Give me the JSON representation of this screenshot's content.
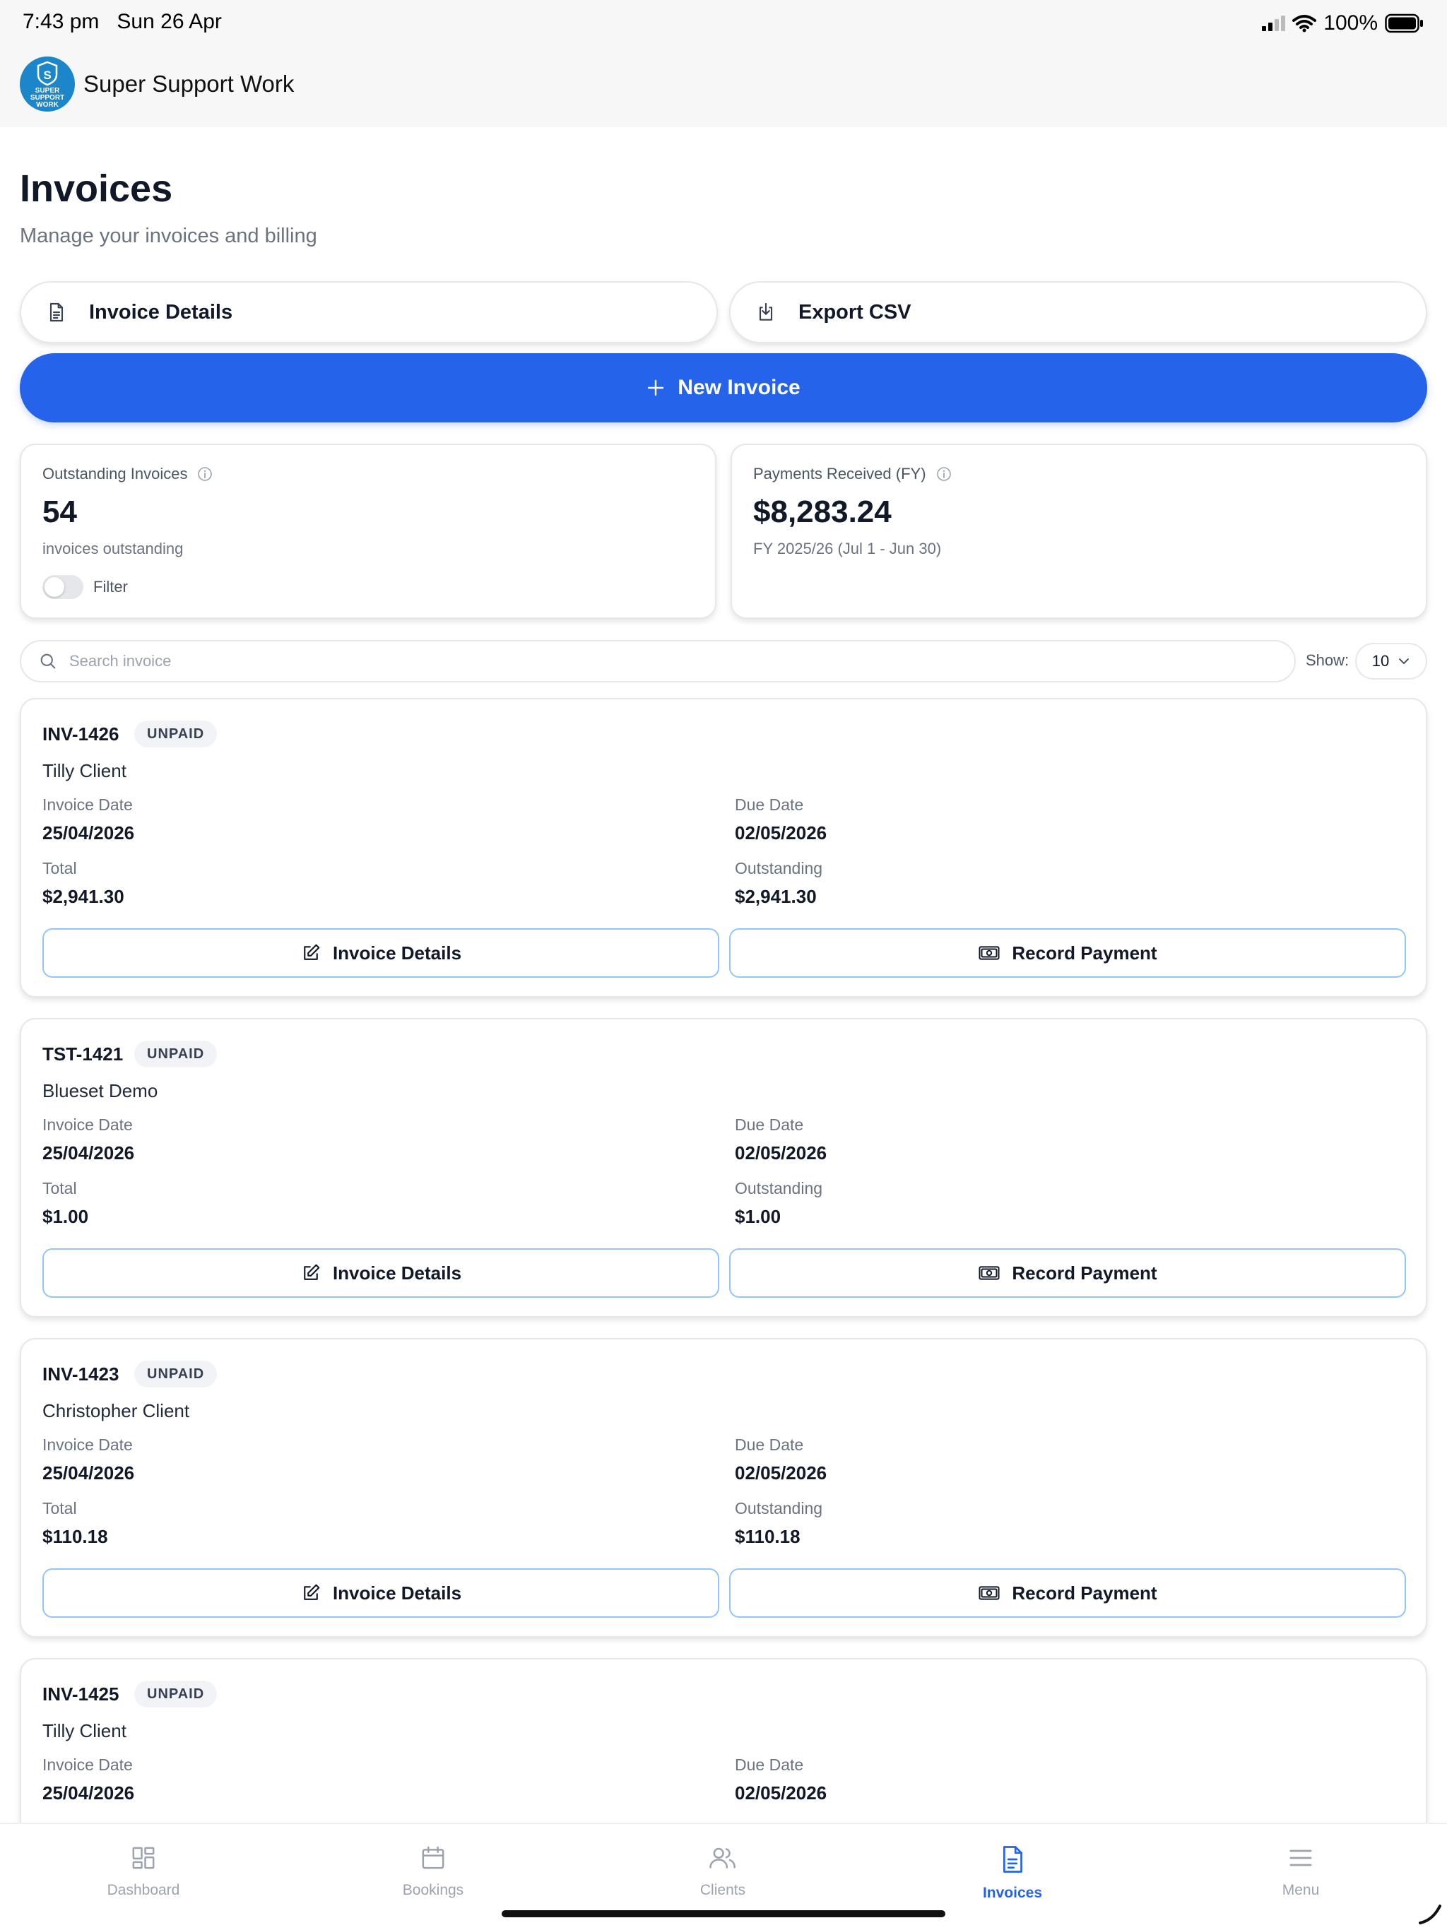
{
  "status_bar": {
    "time": "7:43 pm",
    "date": "Sun 26 Apr",
    "battery": "100%"
  },
  "header": {
    "app_title": "Super Support Work",
    "logo_text": "SUPER SUPPORT WORK",
    "logo_icon": "shield-s-icon"
  },
  "page": {
    "title": "Invoices",
    "subtitle": "Manage your invoices and billing"
  },
  "actions": {
    "invoice_details": "Invoice Details",
    "export_csv": "Export CSV",
    "new_invoice": "New Invoice"
  },
  "stats": {
    "outstanding": {
      "label": "Outstanding Invoices",
      "value": "54",
      "sub": "invoices outstanding",
      "filter_label": "Filter",
      "filter_on": false
    },
    "payments": {
      "label": "Payments Received (FY)",
      "value": "$8,283.24",
      "sub": "FY 2025/26 (Jul 1 - Jun 30)"
    }
  },
  "search": {
    "placeholder": "Search invoice",
    "show_label": "Show:",
    "show_value": "10"
  },
  "labels": {
    "invoice_date": "Invoice Date",
    "due_date": "Due Date",
    "total": "Total",
    "outstanding": "Outstanding",
    "invoice_details_btn": "Invoice Details",
    "record_payment_btn": "Record Payment"
  },
  "invoices": [
    {
      "number": "INV-1426",
      "status": "UNPAID",
      "client": "Tilly Client",
      "invoice_date": "25/04/2026",
      "due_date": "02/05/2026",
      "total": "$2,941.30",
      "outstanding": "$2,941.30"
    },
    {
      "number": "TST-1421",
      "status": "UNPAID",
      "client": "Blueset Demo",
      "invoice_date": "25/04/2026",
      "due_date": "02/05/2026",
      "total": "$1.00",
      "outstanding": "$1.00"
    },
    {
      "number": "INV-1423",
      "status": "UNPAID",
      "client": "Christopher Client",
      "invoice_date": "25/04/2026",
      "due_date": "02/05/2026",
      "total": "$110.18",
      "outstanding": "$110.18"
    },
    {
      "number": "INV-1425",
      "status": "UNPAID",
      "client": "Tilly Client",
      "invoice_date": "25/04/2026",
      "due_date": "02/05/2026"
    }
  ],
  "tabs": [
    {
      "label": "Dashboard",
      "icon": "dashboard-icon",
      "active": false
    },
    {
      "label": "Bookings",
      "icon": "calendar-icon",
      "active": false
    },
    {
      "label": "Clients",
      "icon": "users-icon",
      "active": false
    },
    {
      "label": "Invoices",
      "icon": "document-icon",
      "active": true
    },
    {
      "label": "Menu",
      "icon": "menu-icon",
      "active": false
    }
  ],
  "colors": {
    "accent": "#2563eb",
    "logo": "#1b86c9",
    "button_border": "#93c5fd",
    "badge_bg": "#f1f3f6"
  }
}
